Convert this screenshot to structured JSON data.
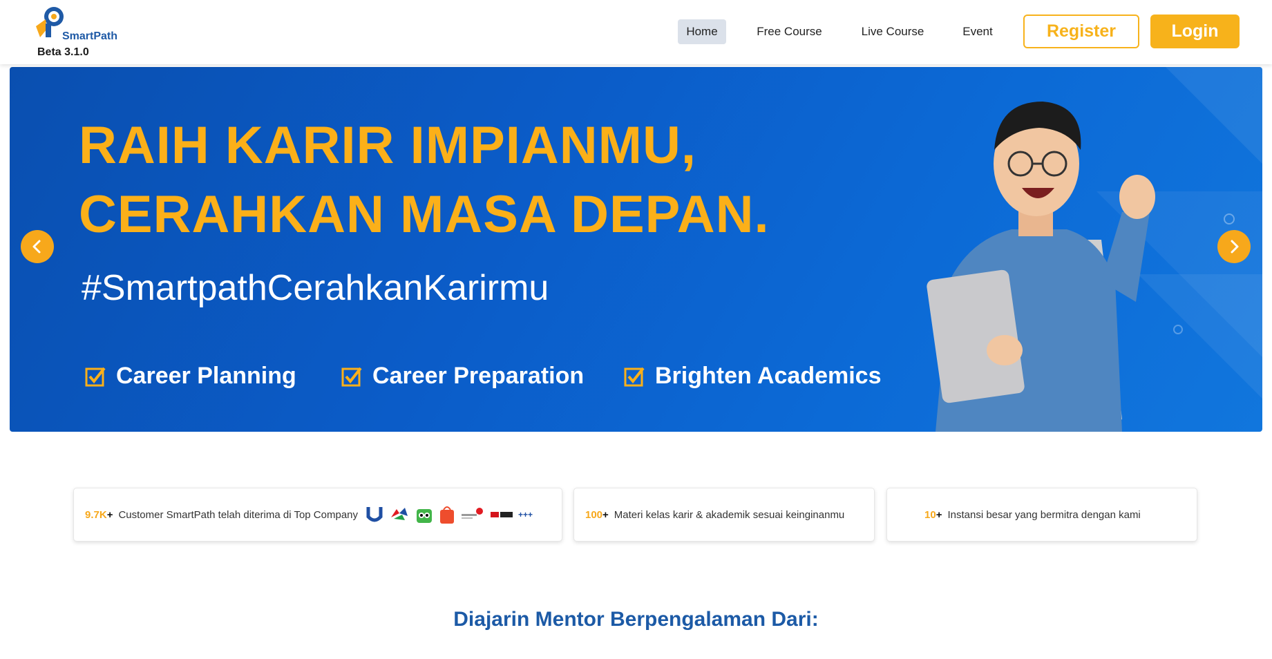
{
  "header": {
    "brand": "SmartPath",
    "version": "Beta 3.1.0",
    "nav": [
      {
        "label": "Home",
        "active": true
      },
      {
        "label": "Free Course",
        "active": false
      },
      {
        "label": "Live Course",
        "active": false
      },
      {
        "label": "Event",
        "active": false
      }
    ],
    "register_label": "Register",
    "login_label": "Login"
  },
  "banner": {
    "headline_line1": "RAIH KARIR IMPIANMU,",
    "headline_line2": "CERAHKAN MASA DEPAN.",
    "hashtag": "#SmartpathCerahkanKarirmu",
    "features": [
      "Career Planning",
      "Career Preparation",
      "Brighten Academics"
    ],
    "prev_icon": "chevron-left-icon",
    "next_icon": "chevron-right-icon"
  },
  "stats": [
    {
      "number": "9.7K",
      "plus": "+",
      "text": "Customer SmartPath telah diterima di Top Company",
      "partner_logos": [
        "Unilever",
        "Pertamina",
        "Tokopedia",
        "Shopee",
        "Telkom Indonesia",
        "tvOne",
        "+++"
      ]
    },
    {
      "number": "100",
      "plus": "+",
      "text": "Materi kelas karir & akademik sesuai keinginanmu"
    },
    {
      "number": "10",
      "plus": "+",
      "text": "Instansi besar yang bermitra dengan kami"
    }
  ],
  "section_title": "Diajarin Mentor Berpengalaman Dari:",
  "colors": {
    "accent": "#f7b21b",
    "brand_blue": "#1c5aa6",
    "banner_blue": "#0b5cc8"
  }
}
